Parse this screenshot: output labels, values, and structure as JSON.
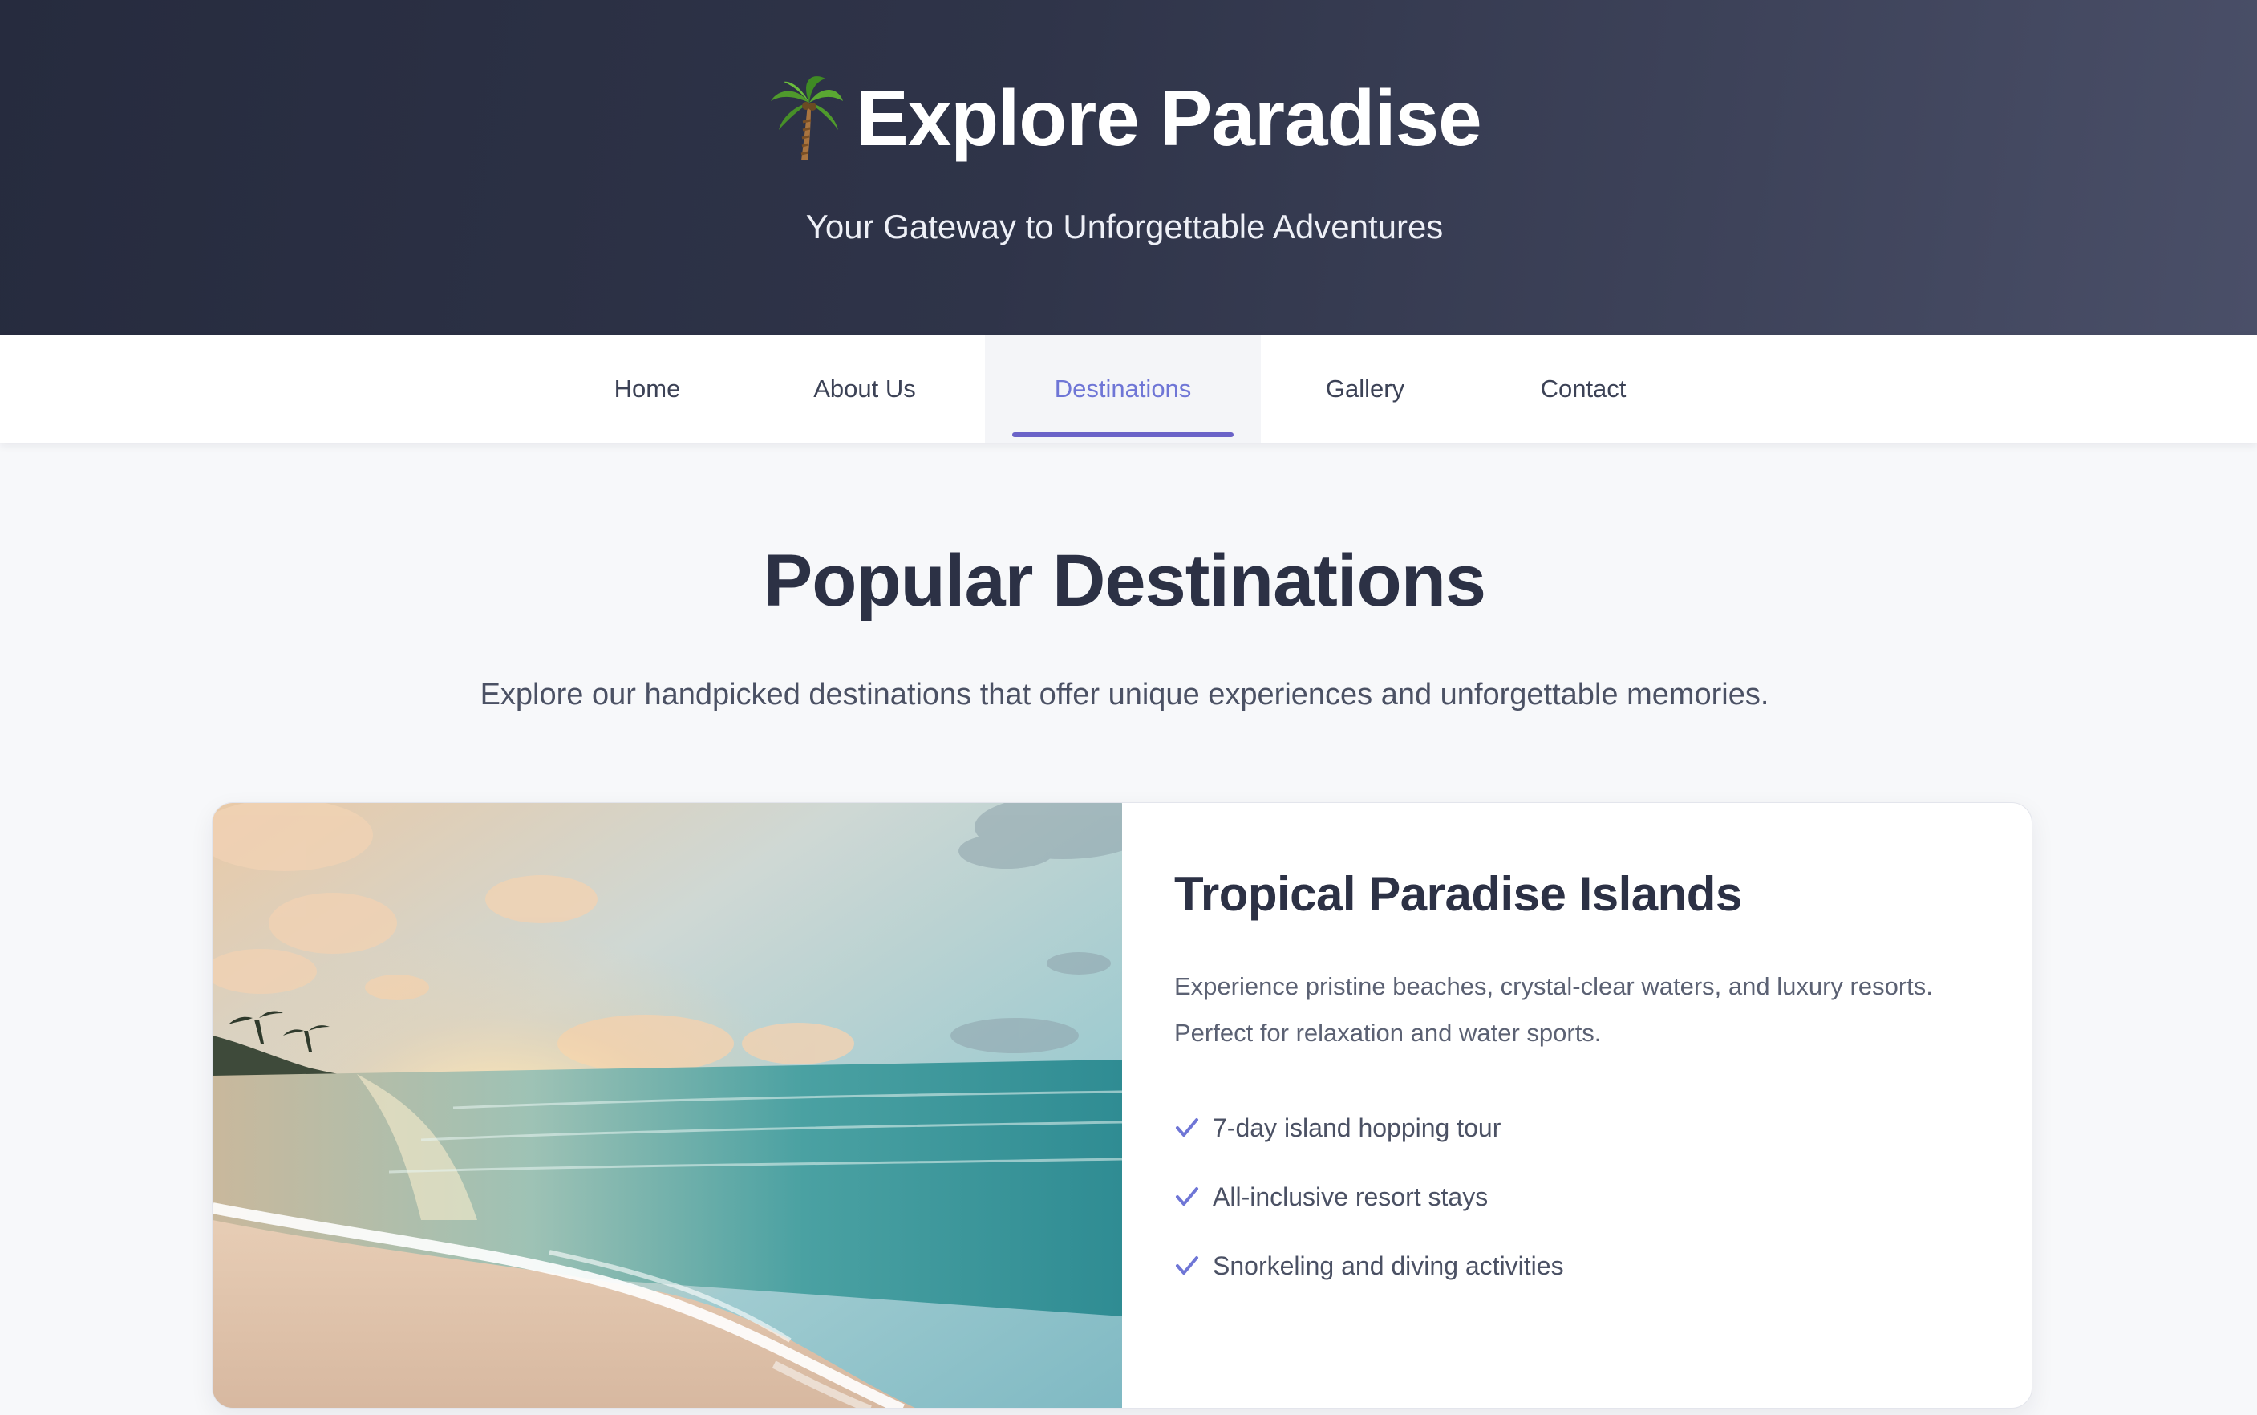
{
  "header": {
    "title": "Explore Paradise",
    "tagline": "Your Gateway to Unforgettable Adventures",
    "logo_icon": "palm-tree-icon"
  },
  "nav": {
    "items": [
      {
        "label": "Home",
        "active": false
      },
      {
        "label": "About Us",
        "active": false
      },
      {
        "label": "Destinations",
        "active": true
      },
      {
        "label": "Gallery",
        "active": false
      },
      {
        "label": "Contact",
        "active": false
      }
    ]
  },
  "main": {
    "title": "Popular Destinations",
    "subtitle": "Explore our handpicked destinations that offer unique experiences and unforgettable memories."
  },
  "destination": {
    "title": "Tropical Paradise Islands",
    "description": "Experience pristine beaches, crystal-clear waters, and luxury resorts. Perfect for relaxation and water sports.",
    "features": [
      "7-day island hopping tour",
      "All-inclusive resort stays",
      "Snorkeling and diving activities"
    ],
    "feature_icon": "check-icon",
    "image_icon": "beach-sunset-image"
  },
  "colors": {
    "header_dark": "#262b3e",
    "accent": "#6f76d6",
    "underline": "#6b63c8",
    "page_bg": "#f7f8fa"
  }
}
